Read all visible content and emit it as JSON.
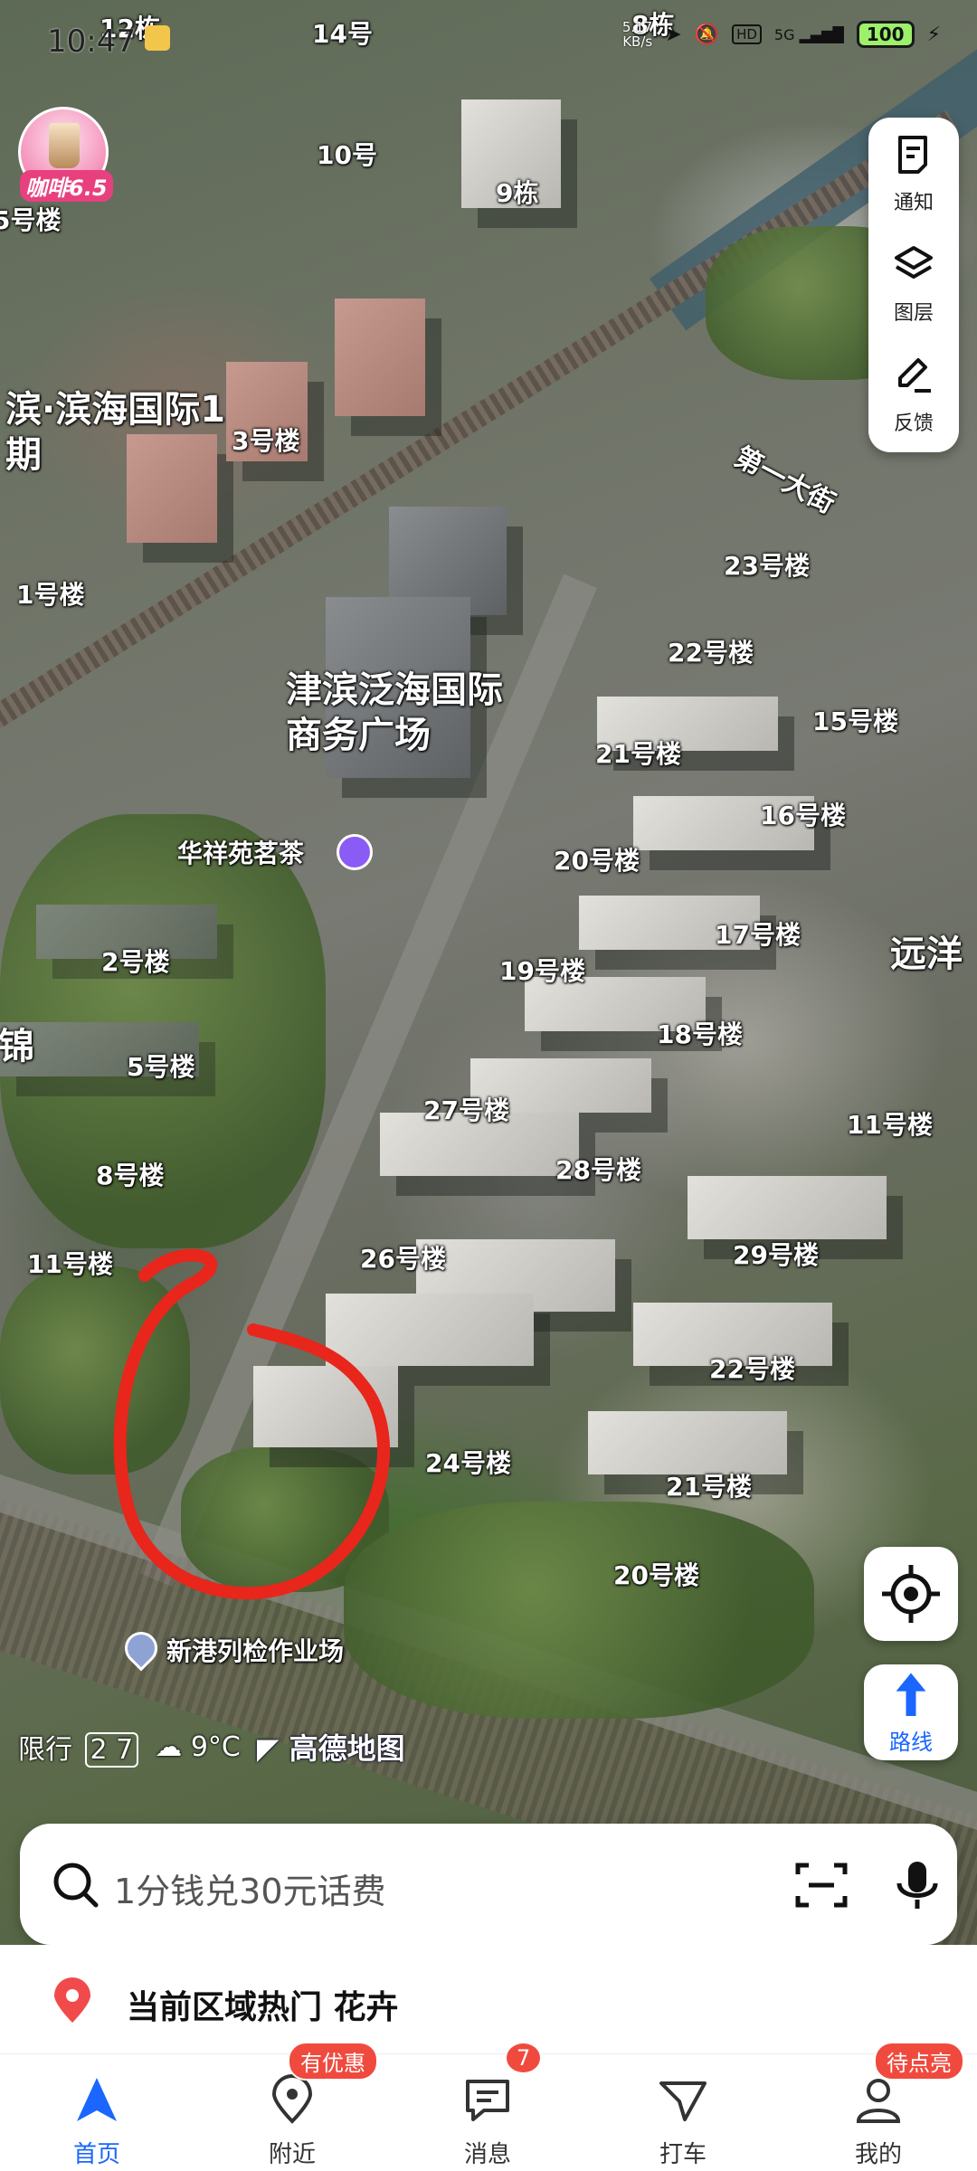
{
  "status_bar": {
    "time": "10:47",
    "net_speed": "5.17",
    "net_unit": "KB/s",
    "hd": "HD",
    "signal": "5G",
    "battery": "100"
  },
  "promo": {
    "label": "咖啡6.5"
  },
  "tools": {
    "notice": "通知",
    "layers": "图层",
    "feedback": "反馈"
  },
  "map_labels": {
    "b12": "12栋",
    "b14": "14号",
    "b8": "8栋",
    "b10": "10号",
    "b9": "9栋",
    "b5left": "5号楼",
    "area_binhai": "滨·滨海国际1期",
    "b3": "3号楼",
    "street_1": "第一大街",
    "b23": "23号楼",
    "b1": "1号楼",
    "b22a": "22号楼",
    "plaza": "津滨泛海国际商务广场",
    "b15": "15号楼",
    "b21a": "21号楼",
    "b16": "16号楼",
    "tea": "华祥苑茗茶",
    "b20a": "20号楼",
    "b17": "17号楼",
    "yuanyang": "远洋",
    "b2": "2号楼",
    "b19": "19号楼",
    "jin": "锦",
    "b18": "18号楼",
    "b5": "5号楼",
    "b27": "27号楼",
    "b11right": "11号楼",
    "b8left": "8号楼",
    "b28": "28号楼",
    "b11left": "11号楼",
    "b26": "26号楼",
    "b29": "29号楼",
    "b22b": "22号楼",
    "b24": "24号楼",
    "b21b": "21号楼",
    "b20b": "20号楼",
    "xingang": "新港列检作业场"
  },
  "map_info": {
    "restriction_label": "限行",
    "restriction_nums": "2 7",
    "weather": "9°C",
    "logo": "高德地图"
  },
  "route_button": {
    "label": "路线"
  },
  "search": {
    "placeholder": "1分钱兑30元话费"
  },
  "hot_area": {
    "text": "当前区域热门 花卉"
  },
  "nav": {
    "home": "首页",
    "nearby": "附近",
    "nearby_badge": "有优惠",
    "messages": "消息",
    "messages_badge": "7",
    "taxi": "打车",
    "mine": "我的",
    "mine_badge": "待点亮"
  },
  "colors": {
    "accent": "#1a66ff",
    "badge": "#f04a3e",
    "annotation": "#e8261b"
  }
}
